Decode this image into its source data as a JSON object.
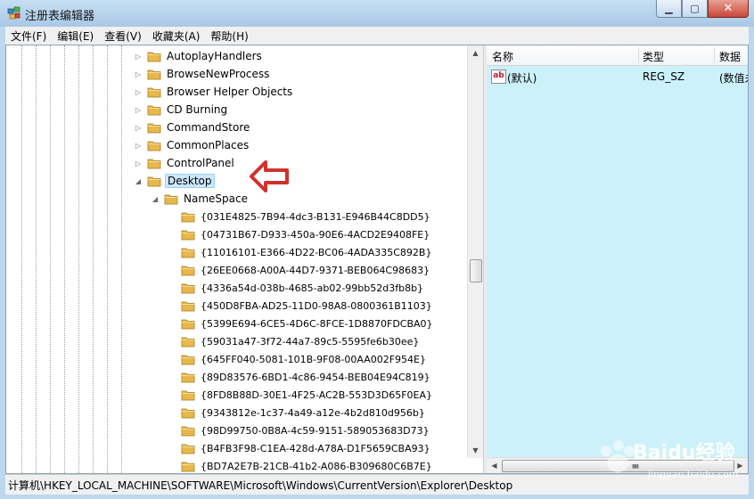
{
  "window": {
    "title": "注册表编辑器"
  },
  "menu": [
    {
      "label": "文件(F)"
    },
    {
      "label": "编辑(E)"
    },
    {
      "label": "查看(V)"
    },
    {
      "label": "收藏夹(A)"
    },
    {
      "label": "帮助(H)"
    }
  ],
  "tree": {
    "siblings": [
      {
        "label": "AutoplayHandlers"
      },
      {
        "label": "BrowseNewProcess"
      },
      {
        "label": "Browser Helper Objects"
      },
      {
        "label": "CD Burning"
      },
      {
        "label": "CommandStore"
      },
      {
        "label": "CommonPlaces"
      },
      {
        "label": "ControlPanel"
      }
    ],
    "selected": {
      "label": "Desktop"
    },
    "child": {
      "label": "NameSpace"
    },
    "guids": [
      {
        "label": "{031E4825-7B94-4dc3-B131-E946B44C8DD5}"
      },
      {
        "label": "{04731B67-D933-450a-90E6-4ACD2E9408FE}"
      },
      {
        "label": "{11016101-E366-4D22-BC06-4ADA335C892B}"
      },
      {
        "label": "{26EE0668-A00A-44D7-9371-BEB064C98683}"
      },
      {
        "label": "{4336a54d-038b-4685-ab02-99bb52d3fb8b}"
      },
      {
        "label": "{450D8FBA-AD25-11D0-98A8-0800361B1103}"
      },
      {
        "label": "{5399E694-6CE5-4D6C-8FCE-1D8870FDCBA0}"
      },
      {
        "label": "{59031a47-3f72-44a7-89c5-5595fe6b30ee}"
      },
      {
        "label": "{645FF040-5081-101B-9F08-00AA002F954E}"
      },
      {
        "label": "{89D83576-6BD1-4c86-9454-BEB04E94C819}"
      },
      {
        "label": "{8FD8B88D-30E1-4F25-AC2B-553D3D65F0EA}"
      },
      {
        "label": "{9343812e-1c37-4a49-a12e-4b2d810d956b}"
      },
      {
        "label": "{98D99750-0B8A-4c59-9151-589053683D73}"
      },
      {
        "label": "{B4FB3F98-C1EA-428d-A78A-D1F5659CBA93}"
      },
      {
        "label": "{BD7A2E7B-21CB-41b2-A086-B309680C6B7E}"
      }
    ]
  },
  "list": {
    "columns": {
      "name": "名称",
      "type": "类型",
      "data": "数据"
    },
    "rows": [
      {
        "name": "(默认)",
        "type": "REG_SZ",
        "data": "(数值未"
      }
    ]
  },
  "status": {
    "path": "计算机\\HKEY_LOCAL_MACHINE\\SOFTWARE\\Microsoft\\Windows\\CurrentVersion\\Explorer\\Desktop"
  },
  "watermark": {
    "text": "Baidu经验",
    "sub": "jingyan.baidu.com"
  },
  "colors": {
    "list_bg": "#ccf1fb",
    "annotation_arrow": "#d0312d",
    "folder": "#e8b94a"
  }
}
